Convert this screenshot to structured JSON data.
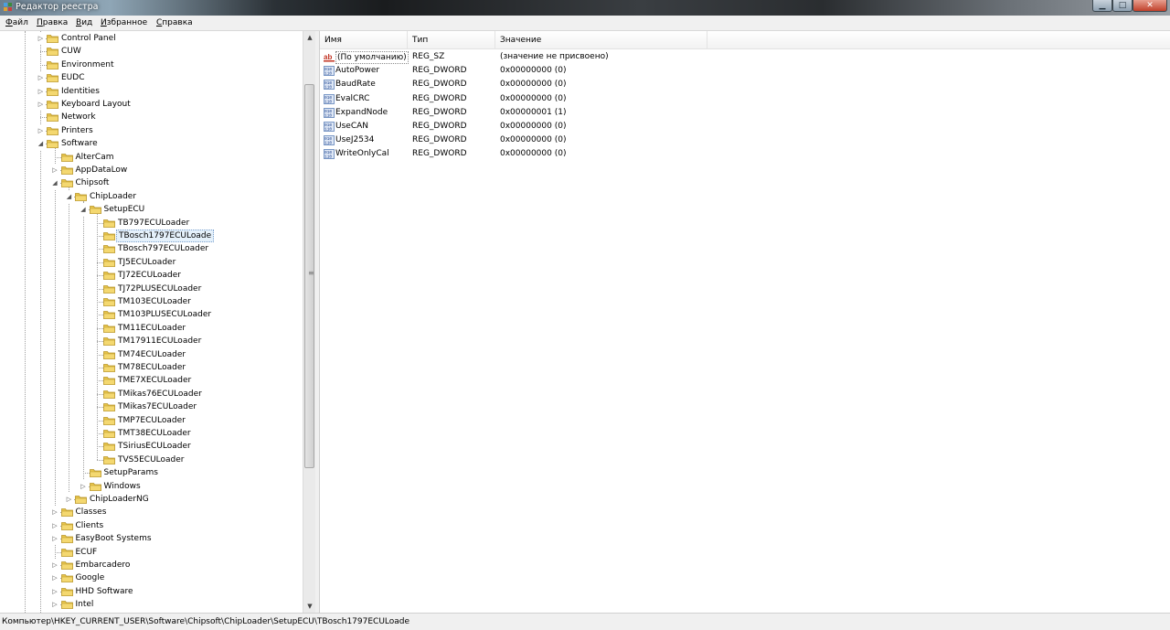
{
  "window": {
    "title": "Редактор реестра",
    "controls": {
      "minimize": "▁",
      "maximize": "□",
      "close": "✕"
    }
  },
  "menu": [
    {
      "accel": "Ф",
      "rest": "айл"
    },
    {
      "accel": "П",
      "rest": "равка"
    },
    {
      "accel": "В",
      "rest": "ид"
    },
    {
      "accel": "И",
      "rest": "збранное"
    },
    {
      "accel": "С",
      "rest": "правка"
    }
  ],
  "tree": [
    {
      "label": "Control Panel",
      "level": 0,
      "expander": "collapsed"
    },
    {
      "label": "CUW",
      "level": 0,
      "expander": "none"
    },
    {
      "label": "Environment",
      "level": 0,
      "expander": "none"
    },
    {
      "label": "EUDC",
      "level": 0,
      "expander": "collapsed"
    },
    {
      "label": "Identities",
      "level": 0,
      "expander": "collapsed"
    },
    {
      "label": "Keyboard Layout",
      "level": 0,
      "expander": "collapsed"
    },
    {
      "label": "Network",
      "level": 0,
      "expander": "none"
    },
    {
      "label": "Printers",
      "level": 0,
      "expander": "collapsed"
    },
    {
      "label": "Software",
      "level": 0,
      "expander": "expanded"
    },
    {
      "label": "AlterCam",
      "level": 1,
      "expander": "none"
    },
    {
      "label": "AppDataLow",
      "level": 1,
      "expander": "collapsed"
    },
    {
      "label": "Chipsoft",
      "level": 1,
      "expander": "expanded"
    },
    {
      "label": "ChipLoader",
      "level": 2,
      "expander": "expanded"
    },
    {
      "label": "SetupECU",
      "level": 3,
      "expander": "expanded"
    },
    {
      "label": "TB797ECULoader",
      "level": 4,
      "expander": "none"
    },
    {
      "label": "TBosch1797ECULoade",
      "level": 4,
      "expander": "none",
      "selected": true
    },
    {
      "label": "TBosch797ECULoader",
      "level": 4,
      "expander": "none"
    },
    {
      "label": "TJ5ECULoader",
      "level": 4,
      "expander": "none"
    },
    {
      "label": "TJ72ECULoader",
      "level": 4,
      "expander": "none"
    },
    {
      "label": "TJ72PLUSECULoader",
      "level": 4,
      "expander": "none"
    },
    {
      "label": "TM103ECULoader",
      "level": 4,
      "expander": "none"
    },
    {
      "label": "TM103PLUSECULoader",
      "level": 4,
      "expander": "none"
    },
    {
      "label": "TM11ECULoader",
      "level": 4,
      "expander": "none"
    },
    {
      "label": "TM17911ECULoader",
      "level": 4,
      "expander": "none"
    },
    {
      "label": "TM74ECULoader",
      "level": 4,
      "expander": "none"
    },
    {
      "label": "TM78ECULoader",
      "level": 4,
      "expander": "none"
    },
    {
      "label": "TME7XECULoader",
      "level": 4,
      "expander": "none"
    },
    {
      "label": "TMikas76ECULoader",
      "level": 4,
      "expander": "none"
    },
    {
      "label": "TMikas7ECULoader",
      "level": 4,
      "expander": "none"
    },
    {
      "label": "TMP7ECULoader",
      "level": 4,
      "expander": "none"
    },
    {
      "label": "TMT38ECULoader",
      "level": 4,
      "expander": "none"
    },
    {
      "label": "TSiriusECULoader",
      "level": 4,
      "expander": "none"
    },
    {
      "label": "TVS5ECULoader",
      "level": 4,
      "expander": "none"
    },
    {
      "label": "SetupParams",
      "level": 3,
      "expander": "none"
    },
    {
      "label": "Windows",
      "level": 3,
      "expander": "collapsed"
    },
    {
      "label": "ChipLoaderNG",
      "level": 2,
      "expander": "collapsed"
    },
    {
      "label": "Classes",
      "level": 1,
      "expander": "collapsed"
    },
    {
      "label": "Clients",
      "level": 1,
      "expander": "collapsed"
    },
    {
      "label": "EasyBoot Systems",
      "level": 1,
      "expander": "collapsed"
    },
    {
      "label": "ECUF",
      "level": 1,
      "expander": "none"
    },
    {
      "label": "Embarcadero",
      "level": 1,
      "expander": "collapsed"
    },
    {
      "label": "Google",
      "level": 1,
      "expander": "collapsed"
    },
    {
      "label": "HHD Software",
      "level": 1,
      "expander": "collapsed"
    },
    {
      "label": "Intel",
      "level": 1,
      "expander": "collapsed"
    }
  ],
  "list": {
    "columns": [
      "Имя",
      "Тип",
      "Значение"
    ],
    "rows": [
      {
        "icon": "string-value-icon",
        "name": "(По умолчанию)",
        "type": "REG_SZ",
        "value": "(значение не присвоено)",
        "focused": true
      },
      {
        "icon": "binary-value-icon",
        "name": "AutoPower",
        "type": "REG_DWORD",
        "value": "0x00000000 (0)"
      },
      {
        "icon": "binary-value-icon",
        "name": "BaudRate",
        "type": "REG_DWORD",
        "value": "0x00000000 (0)"
      },
      {
        "icon": "binary-value-icon",
        "name": "EvalCRC",
        "type": "REG_DWORD",
        "value": "0x00000000 (0)"
      },
      {
        "icon": "binary-value-icon",
        "name": "ExpandNode",
        "type": "REG_DWORD",
        "value": "0x00000001 (1)"
      },
      {
        "icon": "binary-value-icon",
        "name": "UseCAN",
        "type": "REG_DWORD",
        "value": "0x00000000 (0)"
      },
      {
        "icon": "binary-value-icon",
        "name": "UseJ2534",
        "type": "REG_DWORD",
        "value": "0x00000000 (0)"
      },
      {
        "icon": "binary-value-icon",
        "name": "WriteOnlyCal",
        "type": "REG_DWORD",
        "value": "0x00000000 (0)"
      }
    ]
  },
  "statusbar": {
    "path": "Компьютер\\HKEY_CURRENT_USER\\Software\\Chipsoft\\ChipLoader\\SetupECU\\TBosch1797ECULoade"
  },
  "colors": {
    "folder": "#e8c54a",
    "selection": "#e5f1fb"
  }
}
